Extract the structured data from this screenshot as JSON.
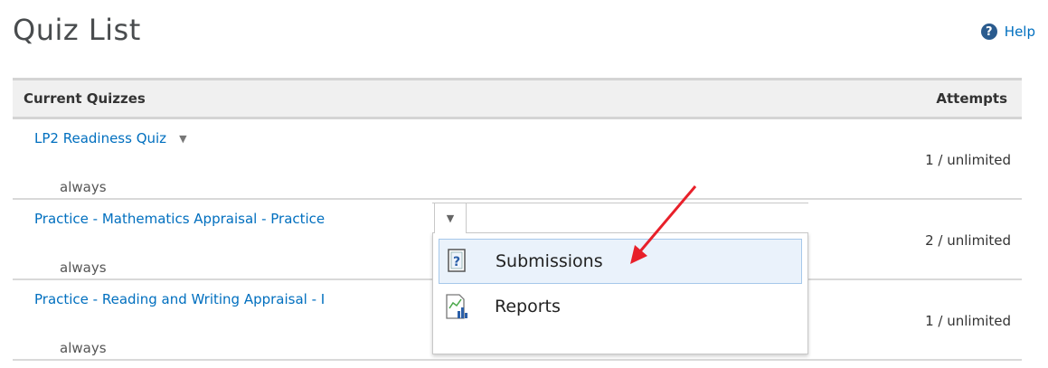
{
  "page": {
    "title": "Quiz List"
  },
  "help": {
    "label": "Help",
    "icon": "help-circle-icon"
  },
  "table": {
    "headers": {
      "name": "Current Quizzes",
      "attempts": "Attempts"
    },
    "rows": [
      {
        "name": "LP2 Readiness Quiz",
        "when": "always",
        "attempts": "1 / unlimited"
      },
      {
        "name": "Practice - Mathematics Appraisal - Practice",
        "when": "always",
        "attempts": "2 / unlimited"
      },
      {
        "name": "Practice - Reading and Writing Appraisal - I",
        "when": "always",
        "attempts": "1 / unlimited"
      }
    ]
  },
  "context_menu": {
    "items": [
      {
        "label": "Submissions",
        "icon": "submissions-icon",
        "active": true
      },
      {
        "label": "Reports",
        "icon": "reports-icon",
        "active": false
      }
    ]
  },
  "colors": {
    "link": "#006fbf",
    "arrow": "#e8202a",
    "menu_hover_bg": "#eaf2fb"
  }
}
